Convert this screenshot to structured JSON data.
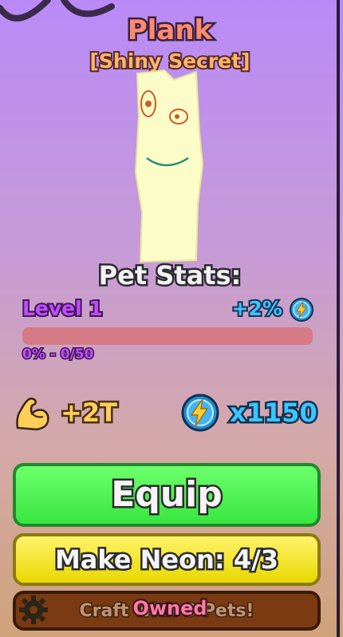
{
  "pet": {
    "name": "Plank",
    "rarity": "[Shiny Secret]"
  },
  "stats": {
    "section_title": "Pet Stats:",
    "level_label": "Level 1",
    "level_bonus": "+2%",
    "progress_text": "0% - 0/50",
    "progress_fraction": 0,
    "strength_bonus": "+2T",
    "energy_multiplier": "x1150"
  },
  "buttons": {
    "equip_label": "Equip",
    "make_neon_label": "Make Neon: 4/3",
    "craft_label": "Craft with 3 Pets!",
    "owned_overlay": "Owned"
  },
  "icons": {
    "strength": "flexed-bicep-icon",
    "energy": "lightning-bolt-icon",
    "gear": "gear-icon"
  },
  "colors": {
    "equip": "#4cf04f",
    "make_neon": "#f2e41e",
    "craft": "#7a3a12",
    "title": "#ff8a6e",
    "rarity": "#ffb46a",
    "level": "#c34bff",
    "energy": "#38c6ff",
    "strength": "#ffcf57"
  }
}
